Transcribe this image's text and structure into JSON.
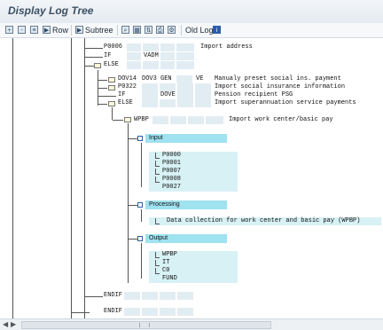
{
  "window": {
    "title": "Display Log Tree"
  },
  "toolbar": {
    "row_label": "Row",
    "subtree_label": "Subtree",
    "old_log_label": "Old Log",
    "info_glyph": "i"
  },
  "tree": {
    "p0006": "P0006",
    "p0006_desc": "Import address",
    "if1": "IF",
    "if1_vadm": "VADM",
    "else1": "ELSE",
    "dov14": "DOV14",
    "dov3": "DOV3",
    "gen": "GEN",
    "ve": "VE",
    "dov_desc": "Manualy preset social ins. payment",
    "p0322": "P0322",
    "p0322_desc": "Import social insurance information",
    "if2": "IF",
    "dove": "DOVE",
    "if2_desc": "Pension recipient PSG",
    "else2": "ELSE",
    "else2_desc": "Import superannuation service payments",
    "wpbp": "WPBP",
    "wpbp_desc": "Import work center/basic pay",
    "input_header": "Input",
    "inputs": [
      "P0000",
      "P0001",
      "P0007",
      "P0008",
      "P0027"
    ],
    "processing_header": "Processing",
    "processing_desc": "Data collection for work center and basic pay (WPBP)",
    "output_header": "Output",
    "outputs": [
      "WPBP",
      "IT",
      "C0",
      "FUND"
    ],
    "endif1": "ENDIF",
    "endif2": "ENDIF"
  }
}
